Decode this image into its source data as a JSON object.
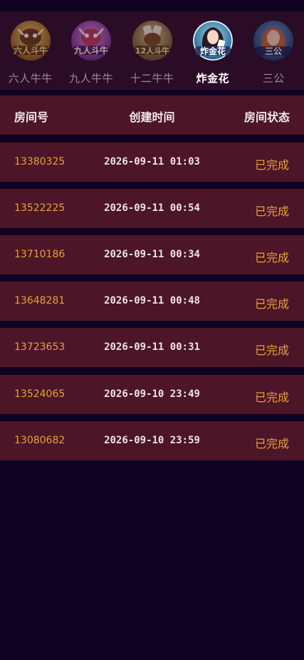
{
  "colors": {
    "background": "#0e0322",
    "tab_bar": "#2a0c26",
    "row_bg": "#4c1528",
    "room_number": "#e8a23a",
    "status_text": "#e8a23a",
    "active_tab_text": "#ffffff",
    "inactive_tab_text": "#9b8898"
  },
  "game_tabs": [
    {
      "label": "六人牛牛",
      "icon": "six-player-niuniu-icon",
      "badge": "六人斗牛",
      "active": false
    },
    {
      "label": "九人牛牛",
      "icon": "nine-player-niuniu-icon",
      "badge": "九人斗牛",
      "active": false
    },
    {
      "label": "十二牛牛",
      "icon": "twelve-player-niuniu-icon",
      "badge": "12人斗牛",
      "active": false
    },
    {
      "label": "炸金花",
      "icon": "zhajinhua-icon",
      "badge": "炸金花",
      "active": true
    },
    {
      "label": "三公",
      "icon": "sangong-icon",
      "badge": "三公",
      "active": false
    }
  ],
  "table": {
    "columns": {
      "room": "房间号",
      "created_time": "创建时间",
      "status": "房间状态"
    },
    "rows": [
      {
        "room": "13380325",
        "time": "2026-09-11 01:03",
        "status": "已完成"
      },
      {
        "room": "13522225",
        "time": "2026-09-11 00:54",
        "status": "已完成"
      },
      {
        "room": "13710186",
        "time": "2026-09-11 00:34",
        "status": "已完成"
      },
      {
        "room": "13648281",
        "time": "2026-09-11 00:48",
        "status": "已完成"
      },
      {
        "room": "13723653",
        "time": "2026-09-11 00:31",
        "status": "已完成"
      },
      {
        "room": "13524065",
        "time": "2026-09-10 23:49",
        "status": "已完成"
      },
      {
        "room": "13080682",
        "time": "2026-09-10 23:59",
        "status": "已完成"
      }
    ]
  }
}
